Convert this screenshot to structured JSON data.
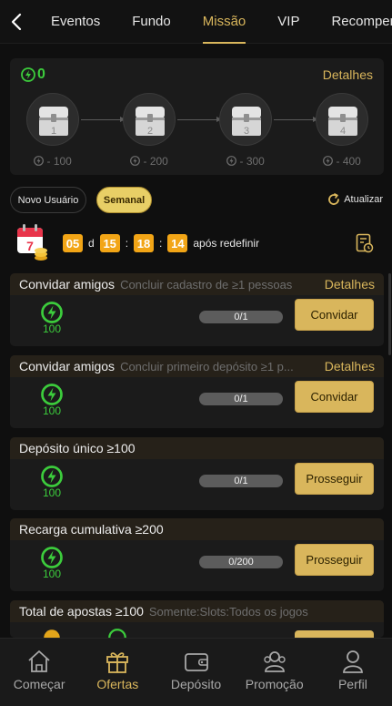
{
  "header": {
    "tabs": [
      {
        "label": "Eventos",
        "active": false
      },
      {
        "label": "Fundo",
        "active": false
      },
      {
        "label": "Missão",
        "active": true
      },
      {
        "label": "VIP",
        "active": false
      },
      {
        "label": "Recompensa",
        "active": false
      }
    ]
  },
  "progress": {
    "points": "0",
    "details_label": "Detalhes",
    "chests": [
      {
        "number": "1",
        "cost": "- 100"
      },
      {
        "number": "2",
        "cost": "- 200"
      },
      {
        "number": "3",
        "cost": "- 300"
      },
      {
        "number": "4",
        "cost": "- 400"
      }
    ]
  },
  "filters": {
    "new_user": "Novo Usuário",
    "weekly": "Semanal",
    "refresh": "Atualizar"
  },
  "countdown": {
    "days": "05",
    "days_unit": "d",
    "hours": "15",
    "minutes": "18",
    "seconds": "14",
    "sep1": ":",
    "sep2": ":",
    "after_text": "após redefinir"
  },
  "missions": [
    {
      "title": "Convidar amigos",
      "desc": "Concluir cadastro de ≥1 pessoas",
      "detail": "Detalhes",
      "reward": "100",
      "progress": "0/1",
      "button": "Convidar"
    },
    {
      "title": "Convidar amigos",
      "desc": "Concluir primeiro depósito ≥1 p...",
      "detail": "Detalhes",
      "reward": "100",
      "progress": "0/1",
      "button": "Convidar"
    },
    {
      "title": "Depósito único ≥100",
      "desc": "",
      "detail": "",
      "reward": "100",
      "progress": "0/1",
      "button": "Prosseguir"
    },
    {
      "title": "Recarga cumulativa ≥200",
      "desc": "",
      "detail": "",
      "reward": "100",
      "progress": "0/200",
      "button": "Prosseguir"
    },
    {
      "title": "Total de apostas ≥100",
      "desc": "Somente:Slots:Todos os jogos",
      "detail": "",
      "reward": "",
      "progress": "",
      "button": ""
    }
  ],
  "bottom_nav": [
    {
      "label": "Começar",
      "icon": "home-icon",
      "active": false
    },
    {
      "label": "Ofertas",
      "icon": "gift-icon",
      "active": true
    },
    {
      "label": "Depósito",
      "icon": "wallet-icon",
      "active": false
    },
    {
      "label": "Promoção",
      "icon": "people-icon",
      "active": false
    },
    {
      "label": "Perfil",
      "icon": "user-icon",
      "active": false
    }
  ],
  "colors": {
    "accent": "#d9b65c",
    "green": "#3ccc3c",
    "orange": "#f2a516",
    "background": "#0f0f0f"
  }
}
